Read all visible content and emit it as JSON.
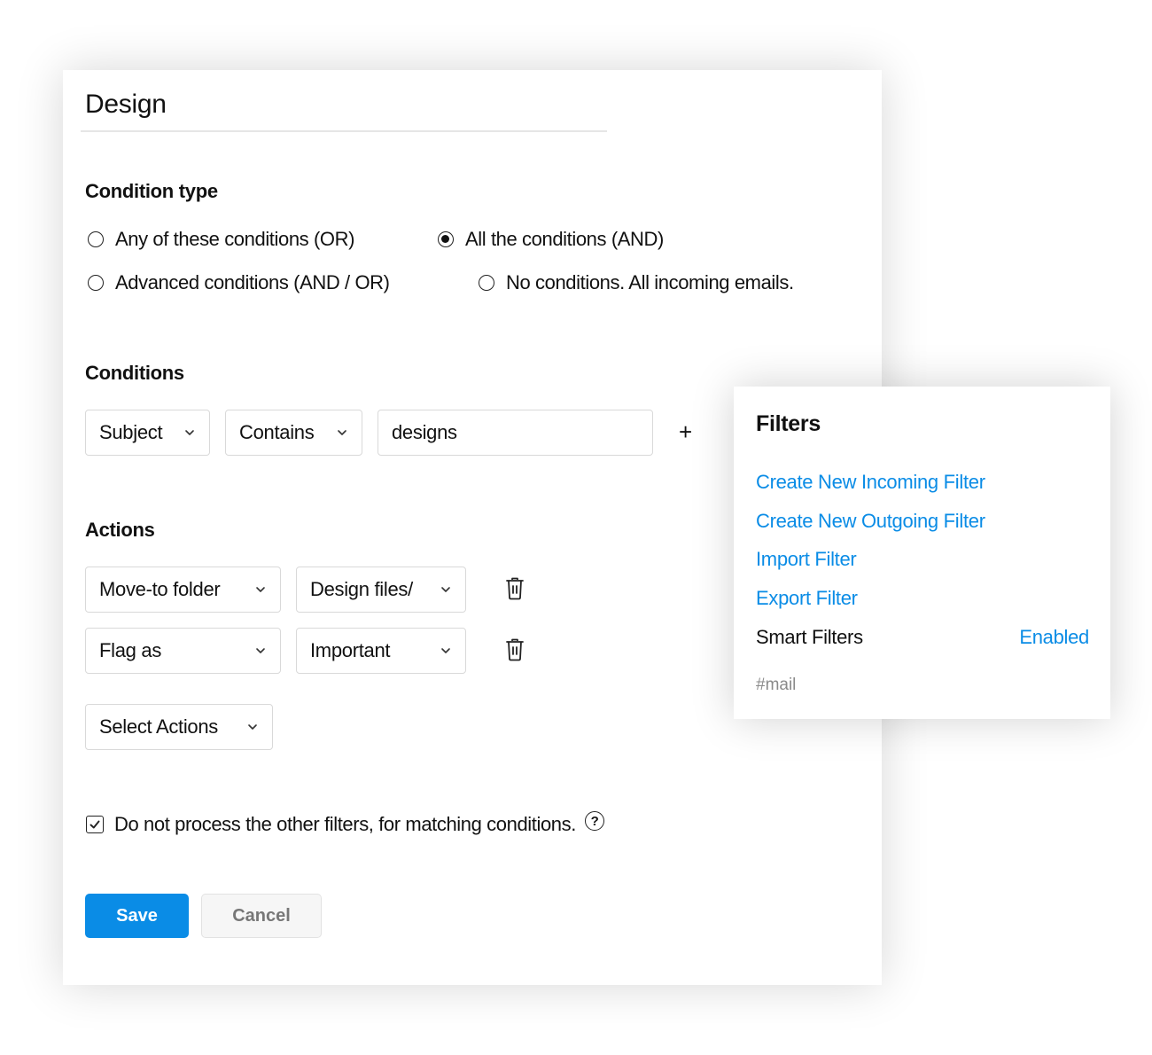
{
  "filter_editor": {
    "title": "Design",
    "condition_type": {
      "heading": "Condition type",
      "options": [
        {
          "label": "Any of these conditions (OR)",
          "checked": false
        },
        {
          "label": "All the conditions (AND)",
          "checked": true
        },
        {
          "label": "Advanced conditions (AND / OR)",
          "checked": false
        },
        {
          "label": "No conditions. All incoming emails.",
          "checked": false
        }
      ]
    },
    "conditions": {
      "heading": "Conditions",
      "field": "Subject",
      "operator": "Contains",
      "value": "designs",
      "add_symbol": "+"
    },
    "actions": {
      "heading": "Actions",
      "rows": [
        {
          "action": "Move-to folder",
          "target": "Design files/"
        },
        {
          "action": "Flag as",
          "target": "Important"
        }
      ],
      "select_placeholder": "Select Actions"
    },
    "stop_processing": {
      "label": "Do not process the other filters, for matching conditions.",
      "checked": true,
      "help_symbol": "?"
    },
    "buttons": {
      "save": "Save",
      "cancel": "Cancel"
    }
  },
  "filters_panel": {
    "title": "Filters",
    "links": [
      "Create New Incoming Filter",
      "Create New Outgoing Filter",
      "Import Filter",
      "Export Filter"
    ],
    "smart_filters": {
      "label": "Smart Filters",
      "status": "Enabled"
    },
    "tag": "#mail"
  },
  "colors": {
    "accent": "#0a8ce6",
    "text": "#111111",
    "muted": "#8a8a8a",
    "border": "#d9d9d9"
  },
  "icons": {
    "chevron": "chevron-down-icon",
    "trash": "trash-icon",
    "help": "help-circle-icon",
    "check": "checkmark-icon",
    "plus": "plus-icon"
  }
}
